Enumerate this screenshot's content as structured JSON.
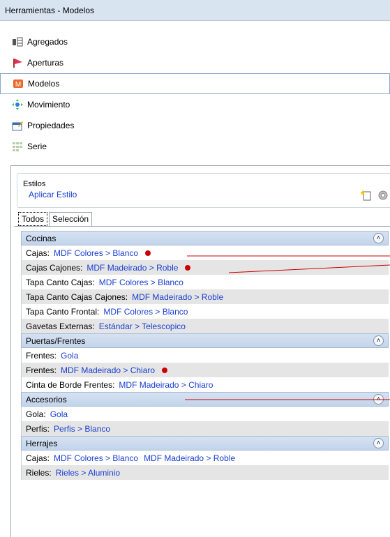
{
  "window": {
    "title": "Herramientas - Modelos"
  },
  "nav": [
    {
      "label": "Agregados",
      "icon": "agregados-icon",
      "selected": false
    },
    {
      "label": "Aperturas",
      "icon": "aperturas-flag-icon",
      "selected": false
    },
    {
      "label": "Modelos",
      "icon": "modelos-icon",
      "selected": true
    },
    {
      "label": "Movimiento",
      "icon": "movimiento-arrows-icon",
      "selected": false
    },
    {
      "label": "Propiedades",
      "icon": "propiedades-icon",
      "selected": false
    },
    {
      "label": "Serie",
      "icon": "serie-grid-icon",
      "selected": false
    }
  ],
  "estilos": {
    "title": "Estilos",
    "apply_link": "Aplicar Estilo",
    "icons": [
      "new-style-icon",
      "settings-gear-icon"
    ]
  },
  "tabs": [
    {
      "label": "Todos",
      "active": true
    },
    {
      "label": "Selección",
      "active": false
    }
  ],
  "groups": [
    {
      "title": "Cocinas",
      "rows": [
        {
          "label": "Cajas:",
          "values": [
            "MDF Colores > Blanco"
          ],
          "marked": true
        },
        {
          "label": "Cajas Cajones:",
          "values": [
            "MDF Madeirado > Roble"
          ],
          "marked": true
        },
        {
          "label": "Tapa Canto Cajas:",
          "values": [
            "MDF Colores > Blanco"
          ],
          "marked": false
        },
        {
          "label": "Tapa Canto Cajas Cajones:",
          "values": [
            "MDF Madeirado > Roble"
          ],
          "marked": false
        },
        {
          "label": "Tapa Canto Frontal:",
          "values": [
            "MDF Colores > Blanco"
          ],
          "marked": false
        },
        {
          "label": "Gavetas Externas:",
          "values": [
            "Estándar > Telescopico"
          ],
          "marked": false
        }
      ]
    },
    {
      "title": "Puertas/Frentes",
      "rows": [
        {
          "label": "Frentes:",
          "values": [
            "Gola"
          ],
          "marked": false
        },
        {
          "label": "Frentes:",
          "values": [
            "MDF Madeirado > Chiaro"
          ],
          "marked": true
        },
        {
          "label": "Cinta de Borde Frentes:",
          "values": [
            "MDF Madeirado > Chiaro"
          ],
          "marked": false
        }
      ]
    },
    {
      "title": "Accesorios",
      "rows": [
        {
          "label": "Gola:",
          "values": [
            "Gola"
          ],
          "marked": false
        },
        {
          "label": "Perfis:",
          "values": [
            "Perfis > Blanco"
          ],
          "marked": false
        }
      ]
    },
    {
      "title": "Herrajes",
      "rows": [
        {
          "label": "Cajas:",
          "values": [
            "MDF Colores > Blanco",
            "MDF Madeirado > Roble"
          ],
          "marked": false
        },
        {
          "label": "Rieles:",
          "values": [
            "Rieles > Aluminio"
          ],
          "marked": false
        }
      ]
    }
  ],
  "colors": {
    "link": "#1a3fd1",
    "marker": "#cc0000",
    "header": "#c9d9ee"
  }
}
